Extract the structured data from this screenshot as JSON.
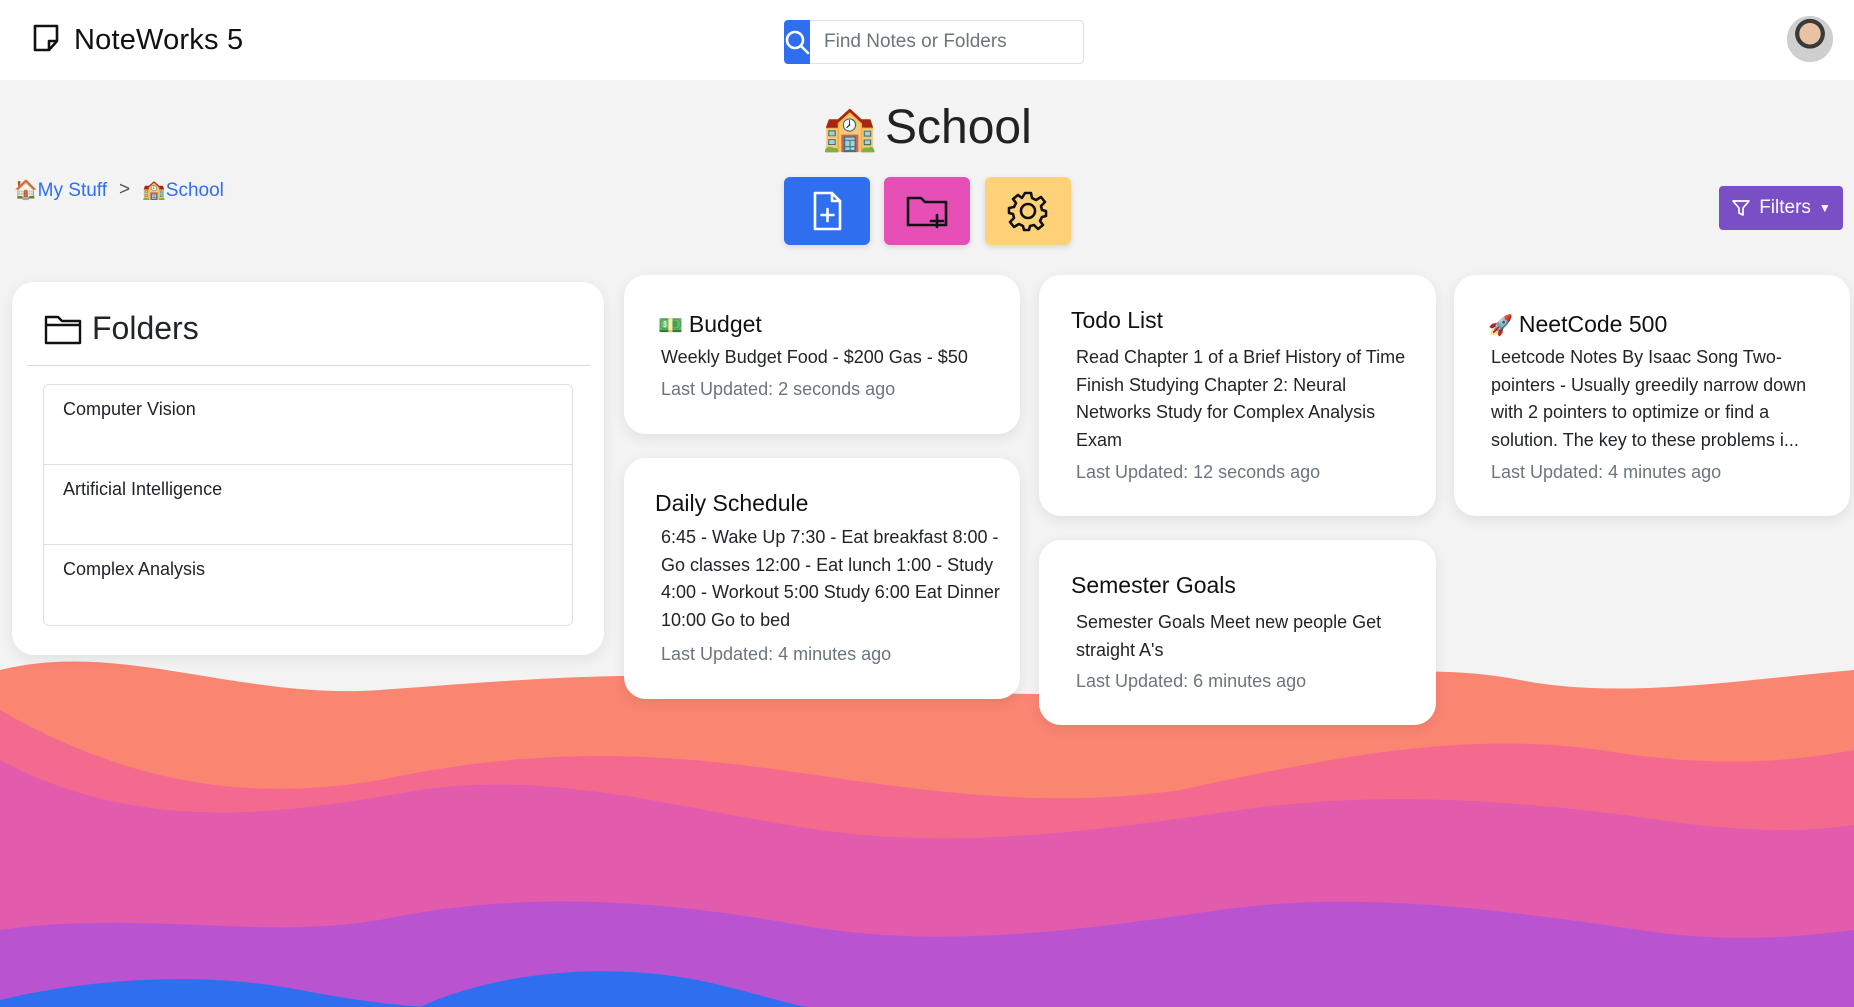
{
  "navbar": {
    "brand": "NoteWorks 5",
    "search_placeholder": "Find Notes or Folders"
  },
  "page": {
    "title_emoji": "🏫",
    "title": "School"
  },
  "breadcrumb": {
    "items": [
      {
        "emoji": "🏠",
        "label": "My Stuff"
      },
      {
        "emoji": "🏫",
        "label": "School"
      }
    ],
    "separator": ">"
  },
  "actions": {
    "filters_label": "Filters"
  },
  "folders": {
    "title": "Folders",
    "items": [
      "Computer Vision",
      "Artificial Intelligence",
      "Complex Analysis"
    ]
  },
  "notes": [
    {
      "emoji": "💵",
      "title": "Budget",
      "body": "Weekly Budget Food - $200 Gas - $50",
      "updated": "Last Updated: 2 seconds ago"
    },
    {
      "emoji": "",
      "title": "Daily Schedule",
      "body": "6:45 - Wake Up 7:30 - Eat breakfast 8:00 - Go classes 12:00 - Eat lunch 1:00 - Study 4:00 - Workout 5:00 Study 6:00 Eat Dinner 10:00 Go to bed",
      "updated": "Last Updated: 4 minutes ago"
    },
    {
      "emoji": "",
      "title": "Todo List",
      "body": "Read Chapter 1 of a Brief History of Time Finish Studying Chapter 2: Neural Networks Study for Complex Analysis Exam",
      "updated": "Last Updated: 12 seconds ago"
    },
    {
      "emoji": "",
      "title": "Semester Goals",
      "body": "Semester Goals Meet new people Get straight A's",
      "updated": "Last Updated: 6 minutes ago"
    },
    {
      "emoji": "🚀",
      "title": "NeetCode 500",
      "body": "Leetcode Notes By Isaac Song Two-pointers - Usually greedily narrow down with 2 pointers to optimize or find a solution. The key to these problems i...",
      "updated": "Last Updated: 4 minutes ago"
    }
  ],
  "colors": {
    "primary": "#2f6fef",
    "folder_button": "#e64fb6",
    "settings_button": "#ffd27a",
    "filters_button": "#7a4ec4"
  }
}
